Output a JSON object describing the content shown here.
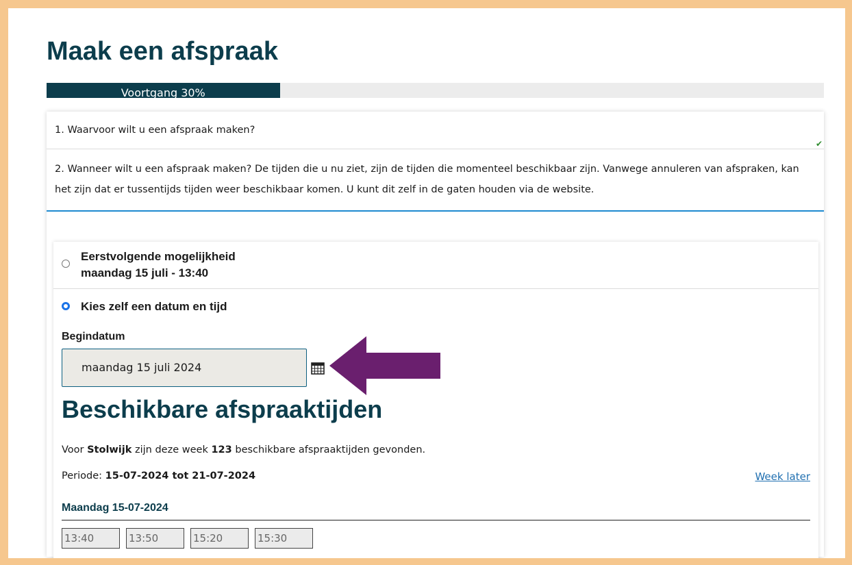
{
  "title": "Maak een afspraak",
  "progress": {
    "label": "Voortgang 30%",
    "percent": 30
  },
  "steps": {
    "step1": "1. Waarvoor wilt u een afspraak maken?",
    "step2": "2. Wanneer wilt u een afspraak maken? De tijden die u nu ziet, zijn de tijden die momenteel beschikbaar zijn. Vanwege annuleren van afspraken, kan het zijn dat er tussentijds tijden weer beschikbaar komen. U kunt dit zelf in de gaten houden via de website."
  },
  "options": {
    "first_label": "Eerstvolgende mogelijkheid",
    "first_value": "maandag 15 juli - 13:40",
    "choose_label": "Kies zelf een datum en tijd",
    "selected": "choose"
  },
  "date": {
    "label": "Begindatum",
    "value": "maandag 15 juli 2024"
  },
  "availability": {
    "title": "Beschikbare afspraaktijden",
    "found_prefix": "Voor ",
    "location": "Stolwijk",
    "found_middle": " zijn deze week ",
    "count": "123",
    "found_suffix": " beschikbare afspraaktijden gevonden.",
    "period_prefix": "Periode: ",
    "period": "15-07-2024 tot 21-07-2024",
    "week_later": "Week later",
    "day": "Maandag 15-07-2024",
    "slots": [
      "13:40",
      "13:50",
      "15:20",
      "15:30"
    ]
  },
  "colors": {
    "accent_dark": "#0c3d4c",
    "frame": "#f6c78e",
    "arrow": "#6a1f6e",
    "link": "#1f6fb0",
    "divider_blue": "#1d8ad0"
  }
}
